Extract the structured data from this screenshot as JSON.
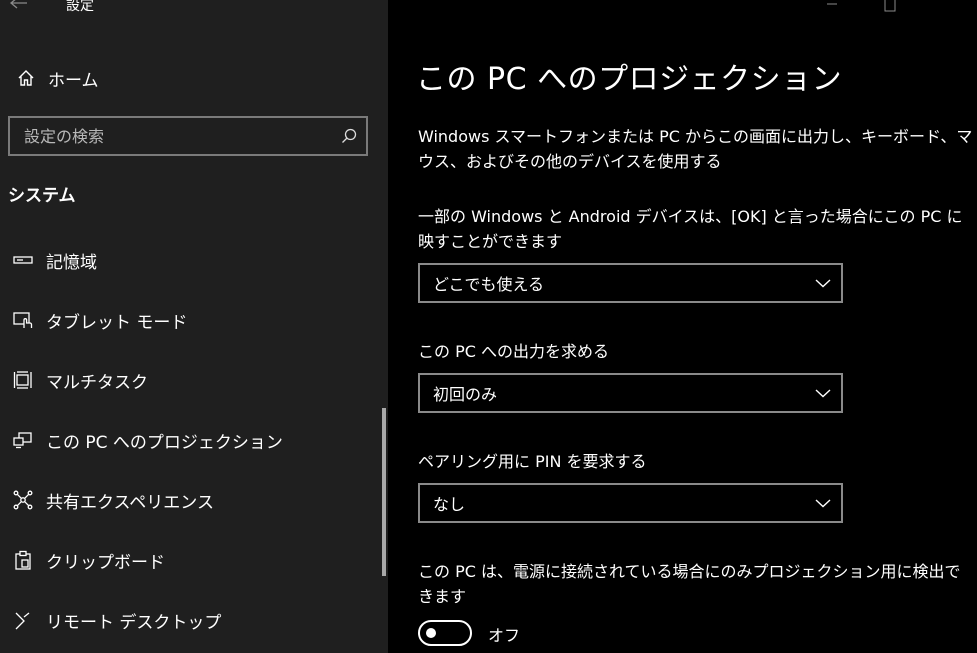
{
  "window": {
    "title": "設定"
  },
  "sidebar": {
    "home_label": "ホーム",
    "search_placeholder": "設定の検索",
    "section": "システム",
    "items": [
      {
        "label": "記憶域",
        "icon": "storage-icon"
      },
      {
        "label": "タブレット モード",
        "icon": "tablet-mode-icon"
      },
      {
        "label": "マルチタスク",
        "icon": "multitasking-icon"
      },
      {
        "label": "この PC へのプロジェクション",
        "icon": "projection-icon"
      },
      {
        "label": "共有エクスペリエンス",
        "icon": "shared-experiences-icon"
      },
      {
        "label": "クリップボード",
        "icon": "clipboard-icon"
      },
      {
        "label": "リモート デスクトップ",
        "icon": "remote-desktop-icon"
      }
    ]
  },
  "main": {
    "title": "この PC へのプロジェクション",
    "description": "Windows スマートフォンまたは PC からこの画面に出力し、キーボード、マウス、およびその他のデバイスを使用する",
    "settings": [
      {
        "label": "一部の Windows と Android デバイスは、[OK] と言った場合にこの PC に映すことができます",
        "value": "どこでも使える"
      },
      {
        "label": "この PC への出力を求める",
        "value": "初回のみ"
      },
      {
        "label": "ペアリング用に PIN を要求する",
        "value": "なし"
      }
    ],
    "power": {
      "label": "この PC は、電源に接続されている場合にのみプロジェクション用に検出できます",
      "toggle_state": "オフ"
    }
  },
  "colors": {
    "sidebar_bg": "#1f1f1f",
    "main_bg": "#000000",
    "border": "#8a8a8a"
  }
}
